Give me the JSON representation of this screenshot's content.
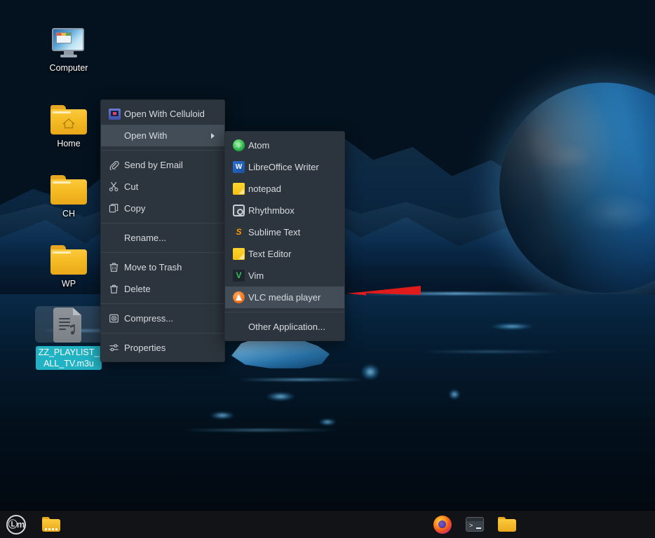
{
  "desktop": {
    "icons": [
      {
        "id": "computer",
        "label": "Computer",
        "icon": "computer-monitor-icon",
        "selected": false
      },
      {
        "id": "home",
        "label": "Home",
        "icon": "home-folder-icon",
        "selected": false
      },
      {
        "id": "ch",
        "label": "CH",
        "icon": "folder-icon",
        "selected": false
      },
      {
        "id": "wp",
        "label": "WP",
        "icon": "folder-icon",
        "selected": false
      },
      {
        "id": "playlist",
        "label": "ZZ_PLAYLIST_ALL_TV.m3u",
        "label_line1": "ZZ_PLAYLIST_",
        "label_line2": "ALL_TV.m3u",
        "icon": "playlist-file-icon",
        "selected": true
      }
    ],
    "selection_color": "#21b2c4"
  },
  "context_menu": {
    "name": "file-context-menu",
    "background_color": "#2c353d",
    "highlight_color": "#424d57",
    "items": [
      {
        "label": "Open With Celluloid",
        "icon": "celluloid-icon",
        "highlighted": false,
        "submenu": false,
        "separator_after": false
      },
      {
        "label": "Open With",
        "icon": null,
        "highlighted": true,
        "submenu": true,
        "separator_after": true
      },
      {
        "label": "Send by Email",
        "icon": "paperclip-icon",
        "highlighted": false,
        "submenu": false,
        "separator_after": false
      },
      {
        "label": "Cut",
        "icon": "scissors-icon",
        "highlighted": false,
        "submenu": false,
        "separator_after": false
      },
      {
        "label": "Copy",
        "icon": "copy-icon",
        "highlighted": false,
        "submenu": false,
        "separator_after": true
      },
      {
        "label": "Rename...",
        "icon": null,
        "highlighted": false,
        "submenu": false,
        "separator_after": true
      },
      {
        "label": "Move to Trash",
        "icon": "trash-icon",
        "highlighted": false,
        "submenu": false,
        "separator_after": false
      },
      {
        "label": "Delete",
        "icon": "delete-icon",
        "highlighted": false,
        "submenu": false,
        "separator_after": true
      },
      {
        "label": "Compress...",
        "icon": "compress-icon",
        "highlighted": false,
        "submenu": false,
        "separator_after": true
      },
      {
        "label": "Properties",
        "icon": "properties-icon",
        "highlighted": false,
        "submenu": false,
        "separator_after": false
      }
    ]
  },
  "open_with_submenu": {
    "name": "open-with-submenu",
    "items": [
      {
        "label": "Atom",
        "icon": "atom-icon",
        "highlighted": false,
        "separator_after": false
      },
      {
        "label": "LibreOffice Writer",
        "icon": "libreoffice-writer-icon",
        "highlighted": false,
        "separator_after": false
      },
      {
        "label": "notepad",
        "icon": "notepad-icon",
        "highlighted": false,
        "separator_after": false
      },
      {
        "label": "Rhythmbox",
        "icon": "rhythmbox-icon",
        "highlighted": false,
        "separator_after": false
      },
      {
        "label": "Sublime Text",
        "icon": "sublime-text-icon",
        "highlighted": false,
        "separator_after": false
      },
      {
        "label": "Text Editor",
        "icon": "text-editor-icon",
        "highlighted": false,
        "separator_after": false
      },
      {
        "label": "Vim",
        "icon": "vim-icon",
        "highlighted": false,
        "separator_after": false
      },
      {
        "label": "VLC media player",
        "icon": "vlc-icon",
        "highlighted": true,
        "separator_after": true
      },
      {
        "label": "Other Application...",
        "icon": null,
        "highlighted": false,
        "separator_after": false
      }
    ]
  },
  "annotation": {
    "name": "red-arrow-annotation",
    "color": "#e01b1b",
    "points_to": "VLC media player",
    "direction": "left"
  },
  "panel": {
    "background_color": "#111317",
    "left_items": [
      {
        "id": "menu",
        "label": "Menu",
        "icon": "linux-mint-menu-icon",
        "text": "Ⓛm"
      },
      {
        "id": "show-desktop-files",
        "label": "Files",
        "icon": "file-manager-icon"
      }
    ],
    "right_items": [
      {
        "id": "firefox",
        "label": "Firefox Web Browser",
        "icon": "firefox-icon"
      },
      {
        "id": "terminal",
        "label": "Terminal",
        "icon": "terminal-icon"
      },
      {
        "id": "files",
        "label": "Files",
        "icon": "folder-icon"
      }
    ]
  }
}
